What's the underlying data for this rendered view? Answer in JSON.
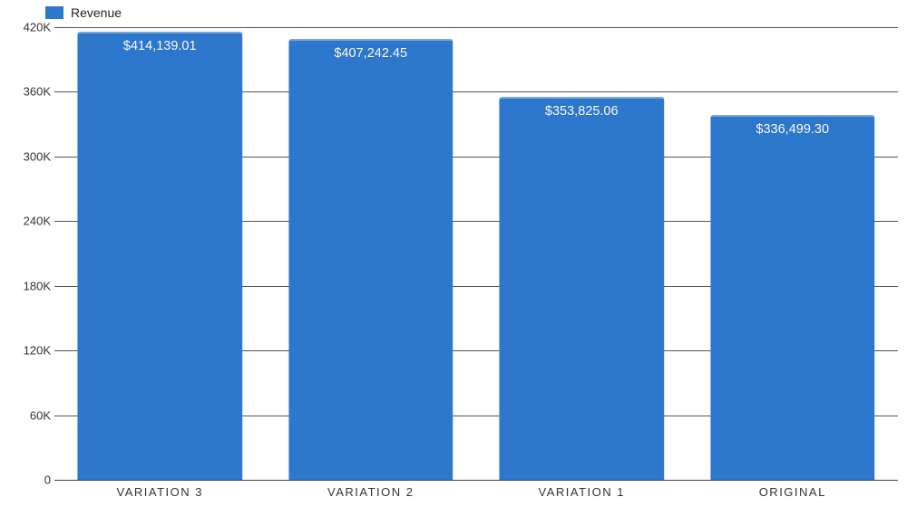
{
  "legend": {
    "label": "Revenue"
  },
  "chart_data": {
    "type": "bar",
    "series_name": "Revenue",
    "categories": [
      "VARIATION 3",
      "VARIATION 2",
      "VARIATION 1",
      "ORIGINAL"
    ],
    "values": [
      414139.01,
      407242.45,
      353825.06,
      336499.3
    ],
    "value_labels": [
      "$414,139.01",
      "$407,242.45",
      "$353,825.06",
      "$336,499.30"
    ],
    "ylim": [
      0,
      420000
    ],
    "y_ticks": [
      0,
      60000,
      120000,
      180000,
      240000,
      300000,
      360000,
      420000
    ],
    "y_tick_labels": [
      "0",
      "60K",
      "120K",
      "180K",
      "240K",
      "300K",
      "360K",
      "420K"
    ],
    "color": "#2d78cd"
  }
}
